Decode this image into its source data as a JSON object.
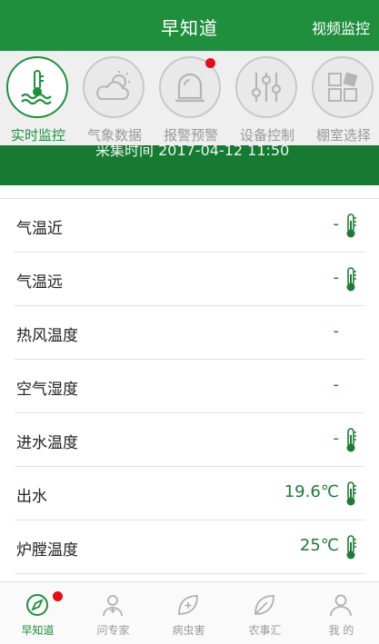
{
  "header": {
    "title": "早知道",
    "video_link": "视频监控"
  },
  "menu": {
    "items": [
      {
        "label": "实时监控",
        "icon": "thermometer-water-icon",
        "active": true
      },
      {
        "label": "气象数据",
        "icon": "cloud-sun-icon",
        "active": false
      },
      {
        "label": "报警预警",
        "icon": "alarm-light-icon",
        "active": false,
        "badge": true
      },
      {
        "label": "设备控制",
        "icon": "sliders-icon",
        "active": false
      },
      {
        "label": "棚室选择",
        "icon": "grid-squares-icon",
        "active": false
      }
    ]
  },
  "collection": {
    "text": "采集时间 2017-04-12 11:50"
  },
  "readings": [
    {
      "name": "气温近",
      "value": "-",
      "thermometer": true
    },
    {
      "name": "气温远",
      "value": "-",
      "thermometer": true
    },
    {
      "name": "热风温度",
      "value": "-",
      "thermometer": false
    },
    {
      "name": "空气湿度",
      "value": "-",
      "thermometer": false
    },
    {
      "name": "进水温度",
      "value": "-",
      "thermometer": true
    },
    {
      "name": "出水",
      "value": "19.6℃",
      "thermometer": true
    },
    {
      "name": "炉膛温度",
      "value": "25℃",
      "thermometer": true
    }
  ],
  "tabbar": {
    "items": [
      {
        "label": "早知道",
        "icon": "compass-icon",
        "active": true,
        "badge": true
      },
      {
        "label": "问专家",
        "icon": "expert-icon",
        "active": false
      },
      {
        "label": "病虫害",
        "icon": "leaf-plus-icon",
        "active": false
      },
      {
        "label": "农事汇",
        "icon": "leaf-icon",
        "active": false
      },
      {
        "label": "我 的",
        "icon": "person-icon",
        "active": false
      }
    ]
  },
  "colors": {
    "brand_green": "#1f8f3e",
    "band_green": "#167a32",
    "badge_red": "#e0101b",
    "inactive_gray": "#9a9a9a"
  }
}
